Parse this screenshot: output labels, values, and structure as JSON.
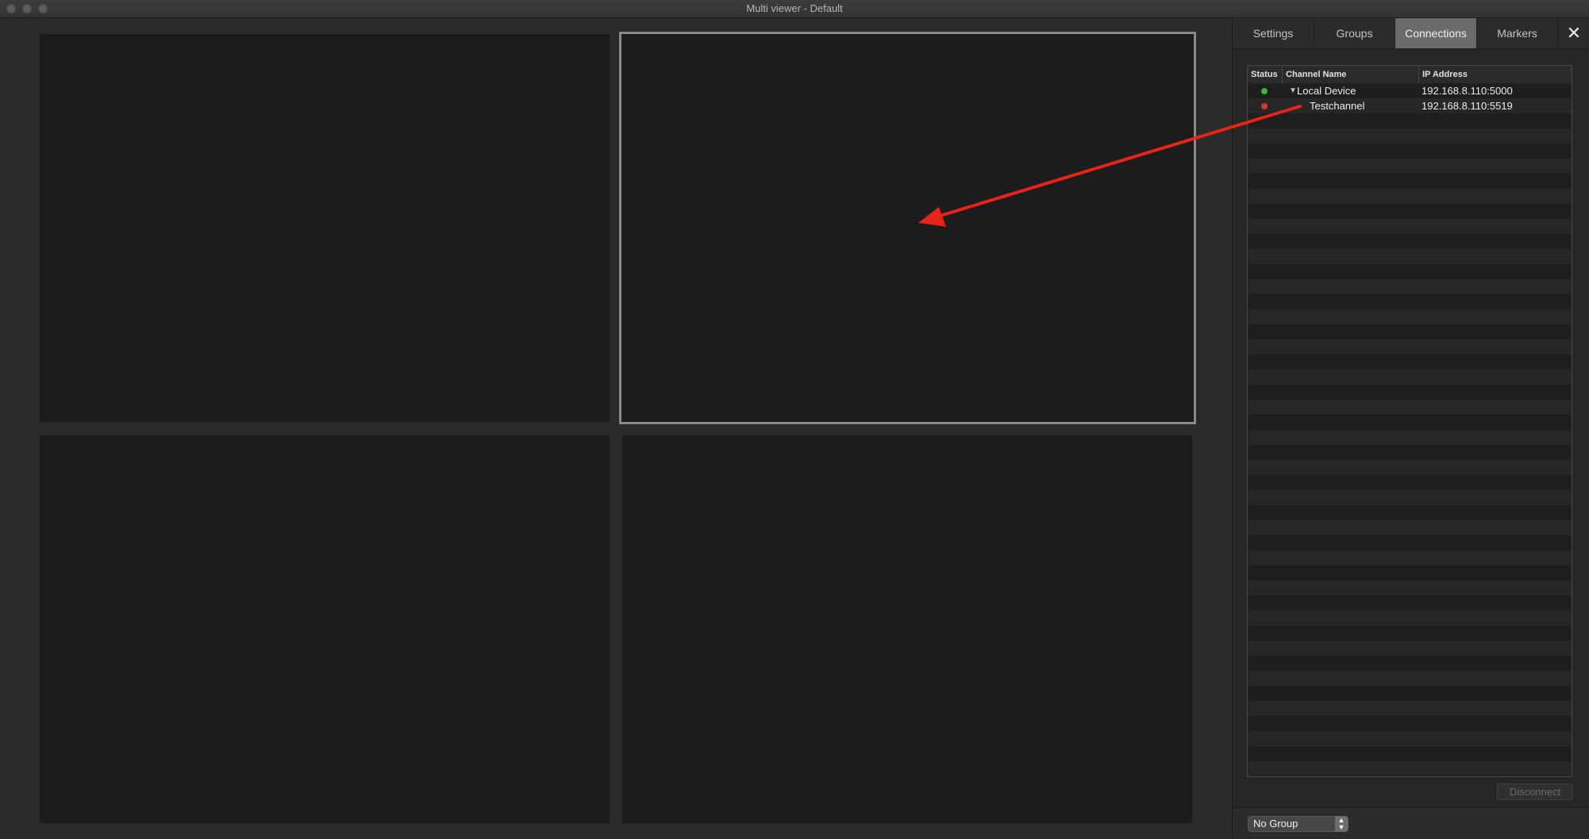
{
  "window": {
    "title": "Multi viewer - Default"
  },
  "panel": {
    "tabs": [
      {
        "label": "Settings",
        "active": false
      },
      {
        "label": "Groups",
        "active": false
      },
      {
        "label": "Connections",
        "active": true
      },
      {
        "label": "Markers",
        "active": false
      }
    ],
    "close_label": "✕",
    "table": {
      "columns": [
        "Status",
        "Channel Name",
        "IP Address"
      ],
      "rows": [
        {
          "status": "connected",
          "status_color": "#2fbf3a",
          "name": "Local Device",
          "ip": "192.168.8.110:5000",
          "expanded": true
        },
        {
          "status": "disconnected",
          "status_color": "#d23a31",
          "name": "Testchannel",
          "ip": "192.168.8.110:5519",
          "expanded": false
        }
      ]
    },
    "disconnect_label": "Disconnect",
    "group_select": {
      "value": "No Group"
    }
  },
  "annotation": {
    "color": "#e8231a"
  }
}
